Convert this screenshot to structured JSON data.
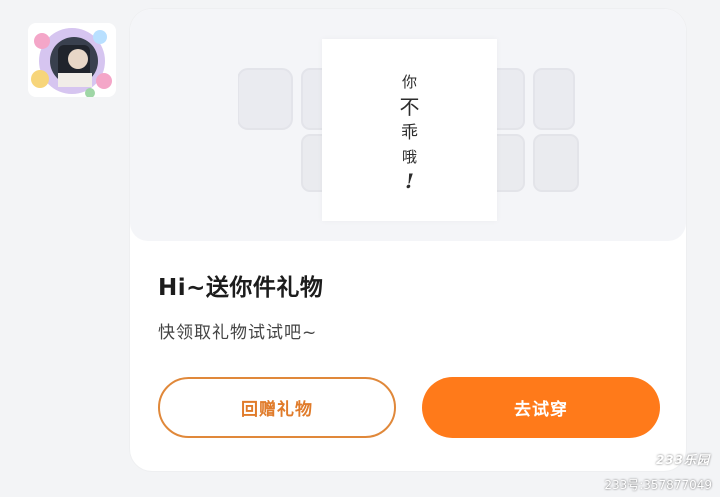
{
  "avatar": {
    "icon": "avatar-photo"
  },
  "card": {
    "gift_image": {
      "characters": [
        "你",
        "不",
        "乖",
        "哦",
        "!"
      ]
    },
    "title": "Hi~送你件礼物",
    "subtitle": "快领取礼物试试吧~",
    "buttons": {
      "return_gift": "回赠礼物",
      "try_on": "去试穿"
    }
  },
  "watermark": {
    "logo": "233乐园",
    "account": "233号:357877049"
  },
  "colors": {
    "accent": "#ff7a1a",
    "outline": "#e0883a",
    "background": "#f3f4f6",
    "card": "#ffffff"
  }
}
